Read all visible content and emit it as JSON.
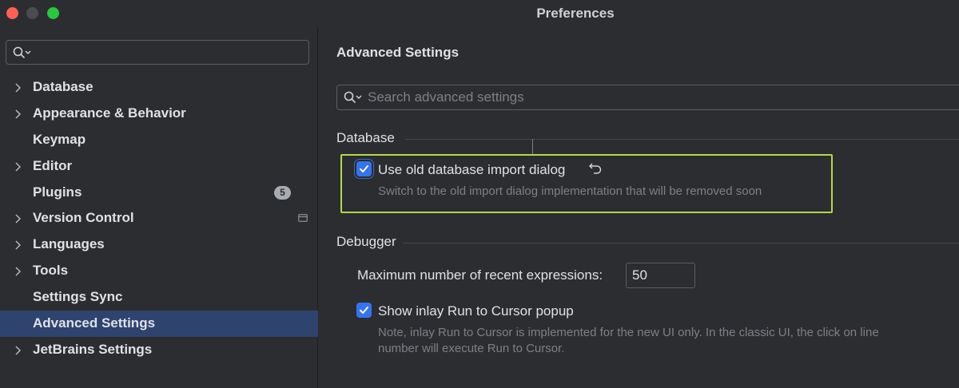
{
  "window": {
    "title": "Preferences"
  },
  "sidebar": {
    "search": {
      "value": "",
      "placeholder": ""
    },
    "items": [
      {
        "label": "Database",
        "expandable": true
      },
      {
        "label": "Appearance & Behavior",
        "expandable": true
      },
      {
        "label": "Keymap",
        "expandable": false
      },
      {
        "label": "Editor",
        "expandable": true
      },
      {
        "label": "Plugins",
        "expandable": false,
        "badge": "5"
      },
      {
        "label": "Version Control",
        "expandable": true,
        "icon": "window-icon"
      },
      {
        "label": "Languages",
        "expandable": true
      },
      {
        "label": "Tools",
        "expandable": true
      },
      {
        "label": "Settings Sync",
        "expandable": false
      },
      {
        "label": "Advanced Settings",
        "expandable": false,
        "selected": true
      },
      {
        "label": "JetBrains Settings",
        "expandable": true
      }
    ]
  },
  "main": {
    "title": "Advanced Settings",
    "search": {
      "value": "",
      "placeholder": "Search advanced settings"
    },
    "sections": {
      "database": {
        "label": "Database",
        "option": {
          "label": "Use old database import dialog",
          "checked": true,
          "description": "Switch to the old import dialog implementation that will be removed soon"
        }
      },
      "debugger": {
        "label": "Debugger",
        "max_expressions": {
          "label": "Maximum number of recent expressions:",
          "value": "50"
        },
        "inlay_option": {
          "label": "Show inlay Run to Cursor popup",
          "checked": true,
          "description_line1": "Note, inlay Run to Cursor is implemented for the new UI only. In the classic UI, the click on line",
          "description_line2": "number will execute Run to Cursor."
        }
      }
    }
  },
  "colors": {
    "background": "#2b2d30",
    "selection": "#2e436e",
    "checkbox": "#3574f0",
    "highlight_border": "#b4d94a"
  }
}
